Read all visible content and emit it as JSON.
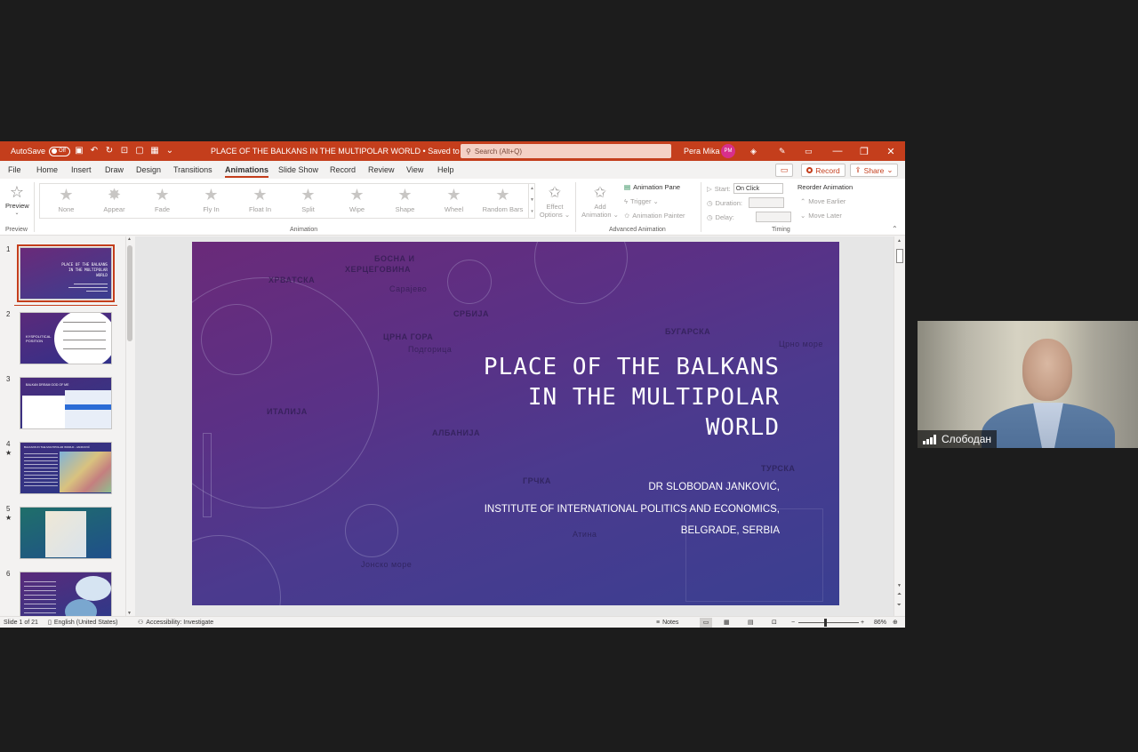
{
  "titlebar": {
    "autosave_label": "AutoSave",
    "autosave_state": "Off",
    "document_title": "PLACE OF THE BALKANS IN THE MULTIPOLAR WORLD • Saved to this PC ⌄",
    "search_placeholder": "Search (Alt+Q)",
    "user_name": "Pera Mika",
    "user_initials": "PM",
    "accent_color": "#c43e1c"
  },
  "menu": {
    "tabs": [
      "File",
      "Home",
      "Insert",
      "Draw",
      "Design",
      "Transitions",
      "Animations",
      "Slide Show",
      "Record",
      "Review",
      "View",
      "Help"
    ],
    "active_tab": "Animations",
    "record_label": "Record",
    "share_label": "Share"
  },
  "ribbon": {
    "preview_label": "Preview",
    "preview_group": "Preview",
    "animation_group": "Animation",
    "animations": [
      "None",
      "Appear",
      "Fade",
      "Fly In",
      "Float In",
      "Split",
      "Wipe",
      "Shape",
      "Wheel",
      "Random Bars"
    ],
    "effect_options_1": "Effect",
    "effect_options_2": "Options ⌄",
    "add_animation_1": "Add",
    "add_animation_2": "Animation ⌄",
    "animation_pane": "Animation Pane",
    "trigger": "Trigger ⌄",
    "animation_painter": "Animation Painter",
    "advanced_group": "Advanced Animation",
    "start_label": "Start:",
    "start_value": "On Click",
    "duration_label": "Duration:",
    "delay_label": "Delay:",
    "timing_group": "Timing",
    "reorder_label": "Reorder Animation",
    "move_earlier": "Move Earlier",
    "move_later": "Move Later"
  },
  "thumbnails": {
    "numbers": [
      "1",
      "2",
      "3",
      "4",
      "5",
      "6"
    ],
    "t1_title": "PLACE OF THE BALKANS IN THE MULTIPOLAR WORLD",
    "t2_title": "KYSPOLITICAL POSITION",
    "t3_title": "BALKAN DREAM GOD OF ME",
    "t4_title": "BALKANS IN THE MULTIPOLAR WORLD - JANKOVIĆ"
  },
  "slide": {
    "title_line1": "PLACE OF THE BALKANS",
    "title_line2": "IN THE MULTIPOLAR",
    "title_line3": "WORLD",
    "sub_line1": "DR SLOBODAN JANKOVIĆ,",
    "sub_line2": "INSTITUTE OF INTERNATIONAL POLITICS AND ECONOMICS,",
    "sub_line3": "BELGRADE, SERBIA",
    "map_labels": [
      "БОСНА И",
      "ХЕРЦЕГОВИНА",
      "ХРВАТСКА",
      "Сарајево",
      "СРБИЈА",
      "ЦРНА ГОРА",
      "Подгорица",
      "БУГАРСКА",
      "Црно море",
      "АЛБАНИЈА",
      "ГРЧКА",
      "Атина",
      "ТУРСКА",
      "Јонско море",
      "ИТАЛИЈА"
    ]
  },
  "statusbar": {
    "slide_counter": "Slide 1 of 21",
    "language": "English (United States)",
    "accessibility": "Accessibility: Investigate",
    "notes": "Notes",
    "zoom": "86%"
  },
  "video": {
    "participant_name": "Слободан"
  }
}
